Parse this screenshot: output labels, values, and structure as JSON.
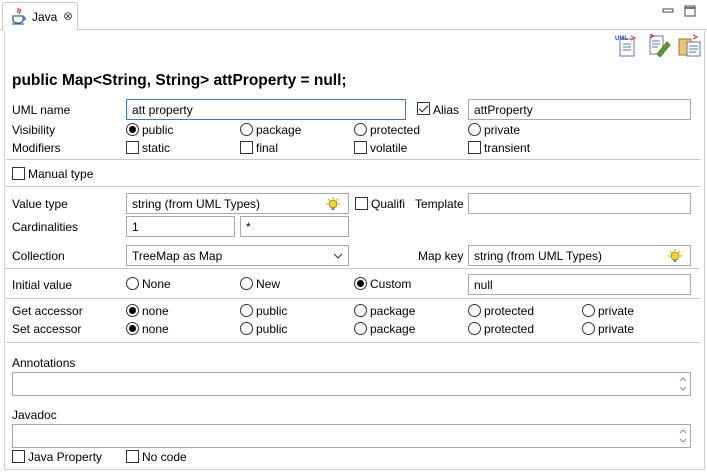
{
  "tab": {
    "title": "Java",
    "close_glyph": "⊗"
  },
  "heading": "public Map<String, String> attProperty = null;",
  "uml_name": {
    "label": "UML name",
    "value": "att property"
  },
  "alias": {
    "label": "Alias",
    "checked": true,
    "value": "attProperty"
  },
  "visibility": {
    "label": "Visibility",
    "options": [
      "public",
      "package",
      "protected",
      "private"
    ],
    "selected": "public"
  },
  "modifiers": {
    "label": "Modifiers",
    "options": [
      "static",
      "final",
      "volatile",
      "transient"
    ]
  },
  "manual_type": {
    "label": "Manual type",
    "checked": false
  },
  "value_type": {
    "label": "Value type",
    "value": "string  (from UML Types)"
  },
  "qualifier": {
    "label": "Qualifi",
    "checked": false
  },
  "template": {
    "label": "Template",
    "value": ""
  },
  "cardinalities": {
    "label": "Cardinalities",
    "lower": "1",
    "upper": "*"
  },
  "collection": {
    "label": "Collection",
    "value": "TreeMap as Map"
  },
  "map_key": {
    "label": "Map key",
    "value": "string  (from UML Types)"
  },
  "initial_value": {
    "label": "Initial value",
    "options": [
      "None",
      "New",
      "Custom"
    ],
    "selected": "Custom",
    "value": "null"
  },
  "get_accessor": {
    "label": "Get accessor",
    "options": [
      "none",
      "public",
      "package",
      "protected",
      "private"
    ],
    "selected": "none"
  },
  "set_accessor": {
    "label": "Set accessor",
    "options": [
      "none",
      "public",
      "package",
      "protected",
      "private"
    ],
    "selected": "none"
  },
  "annotations": {
    "label": "Annotations",
    "value": ""
  },
  "javadoc": {
    "label": "Javadoc",
    "value": ""
  },
  "java_property": {
    "label": "Java Property",
    "checked": false
  },
  "no_code": {
    "label": "No code",
    "checked": false
  },
  "toolbar": {
    "icons": [
      "uml-generate-icon",
      "edit-code-icon",
      "copy-paste-icon"
    ],
    "uml_text": "UML"
  }
}
